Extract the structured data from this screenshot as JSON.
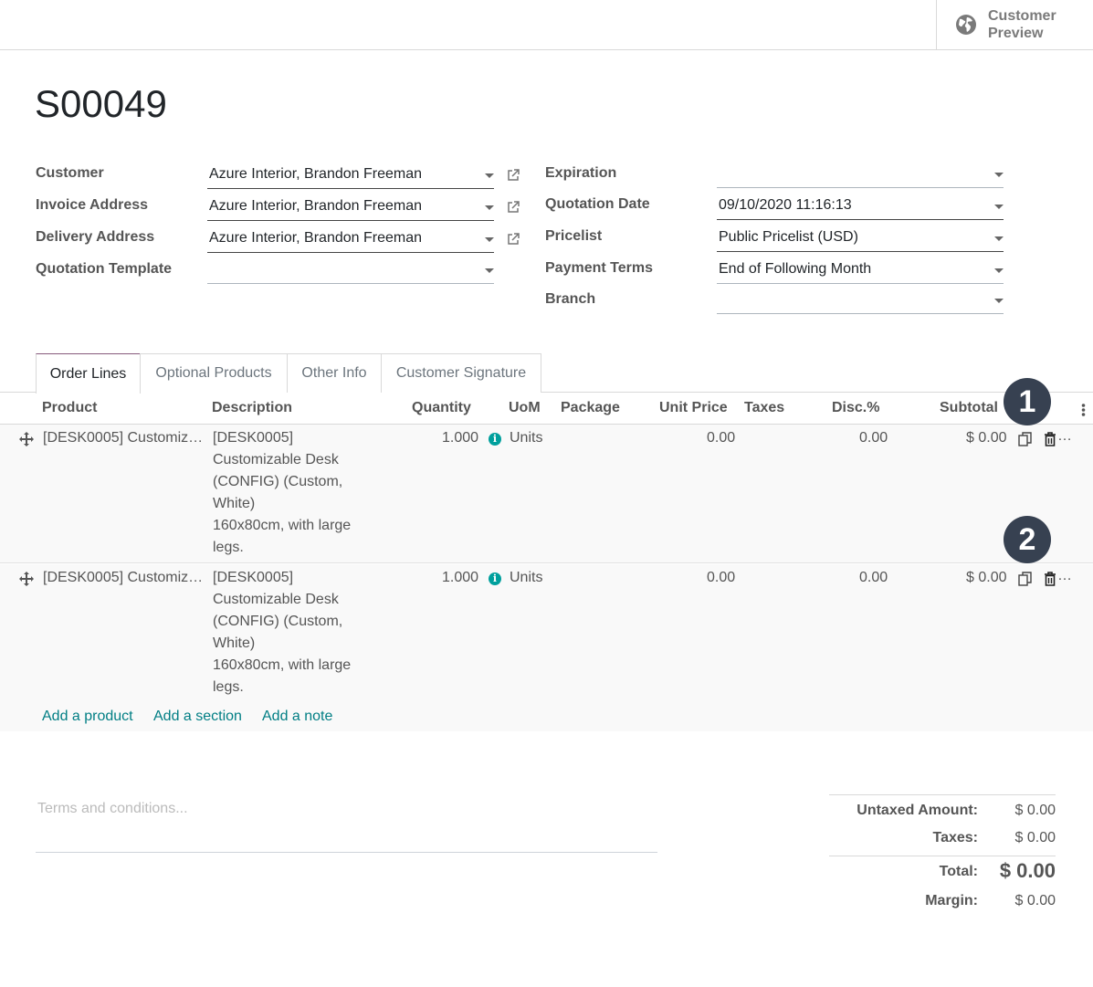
{
  "header": {
    "preview_label_line1": "Customer",
    "preview_label_line2": "Preview",
    "preview_icon": "globe-icon"
  },
  "record": {
    "title": "S00049"
  },
  "form": {
    "customer_label": "Customer",
    "customer_value": "Azure Interior, Brandon Freeman",
    "invoice_label": "Invoice Address",
    "invoice_value": "Azure Interior, Brandon Freeman",
    "delivery_label": "Delivery Address",
    "delivery_value": "Azure Interior, Brandon Freeman",
    "template_label": "Quotation Template",
    "template_value": "",
    "expiration_label": "Expiration",
    "expiration_value": "",
    "quotation_date_label": "Quotation Date",
    "quotation_date_value": "09/10/2020 11:16:13",
    "pricelist_label": "Pricelist",
    "pricelist_value": "Public Pricelist (USD)",
    "payment_terms_label": "Payment Terms",
    "payment_terms_value": "End of Following Month",
    "branch_label": "Branch",
    "branch_value": ""
  },
  "tabs": [
    {
      "label": "Order Lines",
      "active": true
    },
    {
      "label": "Optional Products",
      "active": false
    },
    {
      "label": "Other Info",
      "active": false
    },
    {
      "label": "Customer Signature",
      "active": false
    }
  ],
  "table": {
    "columns": [
      "Product",
      "Description",
      "Quantity",
      "UoM",
      "Package",
      "Unit Price",
      "Taxes",
      "Disc.%",
      "Subtotal"
    ],
    "rows": [
      {
        "product": "[DESK0005] Customiz…",
        "desc_lines": [
          "[DESK0005]",
          "Customizable Desk",
          "(CONFIG) (Custom,",
          "White)",
          "160x80cm, with large",
          "legs."
        ],
        "quantity": "1.000",
        "uom": "Units",
        "unit_price": "0.00",
        "discount": "0.00",
        "subtotal": "$ 0.00"
      },
      {
        "product": "[DESK0005] Customiz…",
        "desc_lines": [
          "[DESK0005]",
          "Customizable Desk",
          "(CONFIG) (Custom,",
          "White)",
          "160x80cm, with large",
          "legs."
        ],
        "quantity": "1.000",
        "uom": "Units",
        "unit_price": "0.00",
        "discount": "0.00",
        "subtotal": "$ 0.00"
      }
    ],
    "add_product": "Add a product",
    "add_section": "Add a section",
    "add_note": "Add a note"
  },
  "badges": {
    "one": "1",
    "two": "2"
  },
  "footer": {
    "terms_placeholder": "Terms and conditions...",
    "untaxed_label": "Untaxed Amount:",
    "untaxed_value": "$ 0.00",
    "taxes_label": "Taxes:",
    "taxes_value": "$ 0.00",
    "total_label": "Total:",
    "total_value": "$ 0.00",
    "margin_label": "Margin:",
    "margin_value": "$ 0.00"
  },
  "colors": {
    "link": "#017e84",
    "info": "#00a09d",
    "badge": "#374151",
    "tab_accent": "#875a7b"
  }
}
